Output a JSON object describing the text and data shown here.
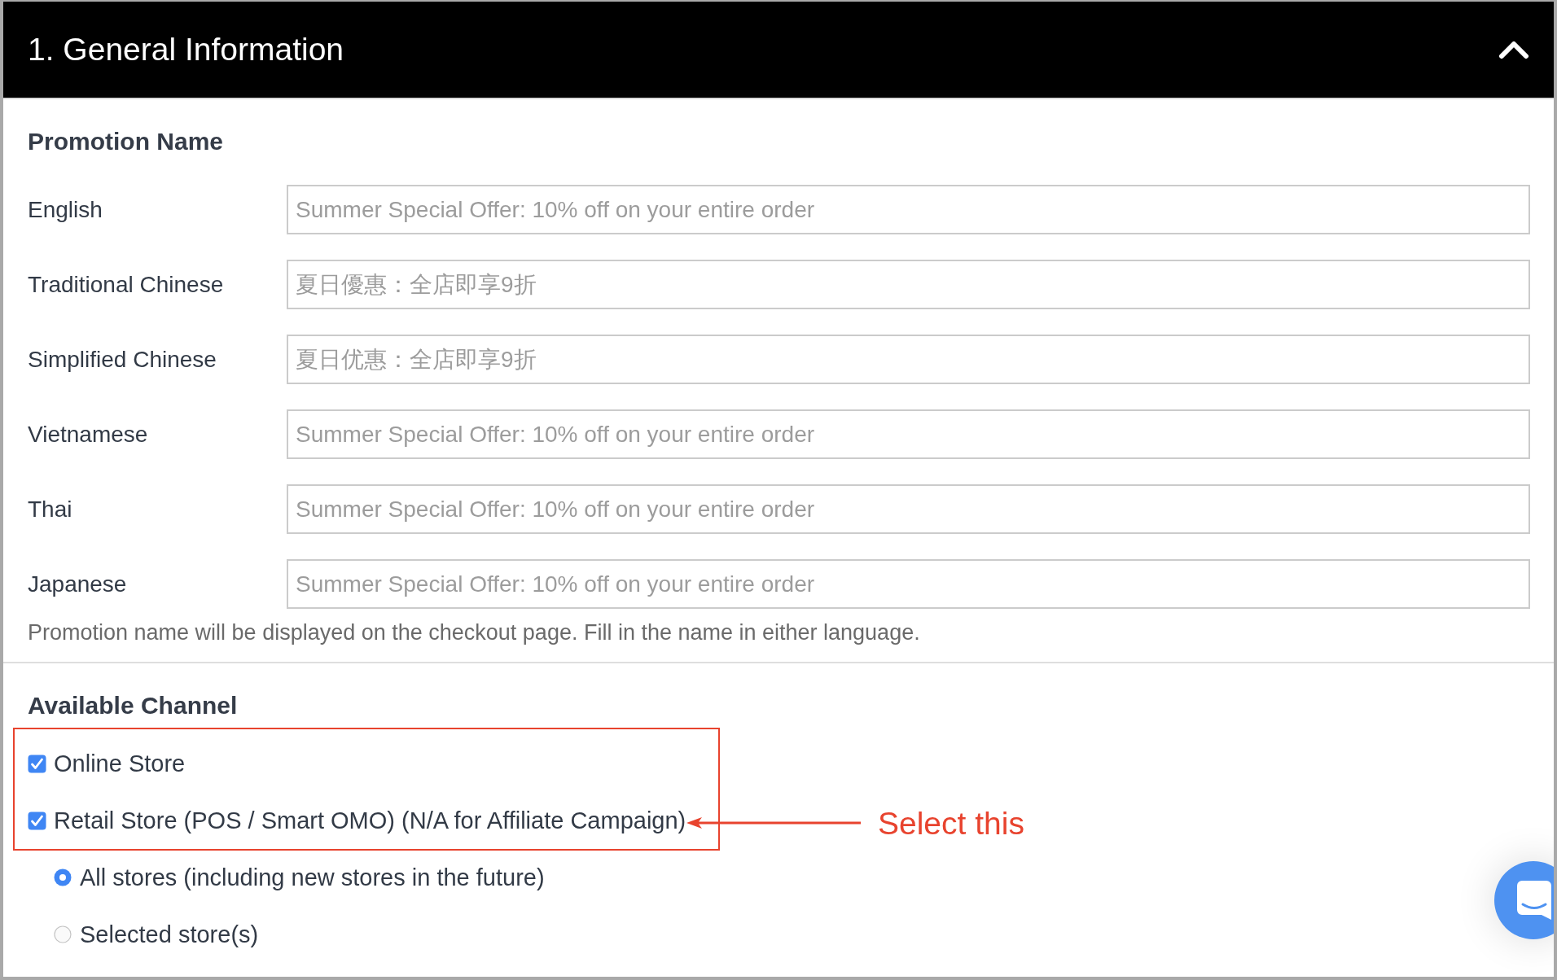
{
  "section": {
    "title": "1. General Information",
    "expanded": true
  },
  "promotion_name": {
    "heading": "Promotion Name",
    "fields": [
      {
        "label": "English",
        "placeholder": "Summer Special Offer: 10% off on your entire order"
      },
      {
        "label": "Traditional Chinese",
        "placeholder": "夏日優惠：全店即享9折"
      },
      {
        "label": "Simplified Chinese",
        "placeholder": "夏日优惠：全店即享9折"
      },
      {
        "label": "Vietnamese",
        "placeholder": "Summer Special Offer: 10% off on your entire order"
      },
      {
        "label": "Thai",
        "placeholder": "Summer Special Offer: 10% off on your entire order"
      },
      {
        "label": "Japanese",
        "placeholder": "Summer Special Offer: 10% off on your entire order"
      }
    ],
    "help_text": "Promotion name will be displayed on the checkout page. Fill in the name in either language."
  },
  "available_channel": {
    "heading": "Available Channel",
    "channels": [
      {
        "label": "Online Store",
        "checked": true
      },
      {
        "label": "Retail Store (POS / Smart OMO) (N/A for Affiliate Campaign)",
        "checked": true
      }
    ],
    "store_options": [
      {
        "label": "All stores (including new stores in the future)",
        "selected": true
      },
      {
        "label": "Selected store(s)",
        "selected": false
      }
    ]
  },
  "annotation": {
    "text": "Select this"
  }
}
